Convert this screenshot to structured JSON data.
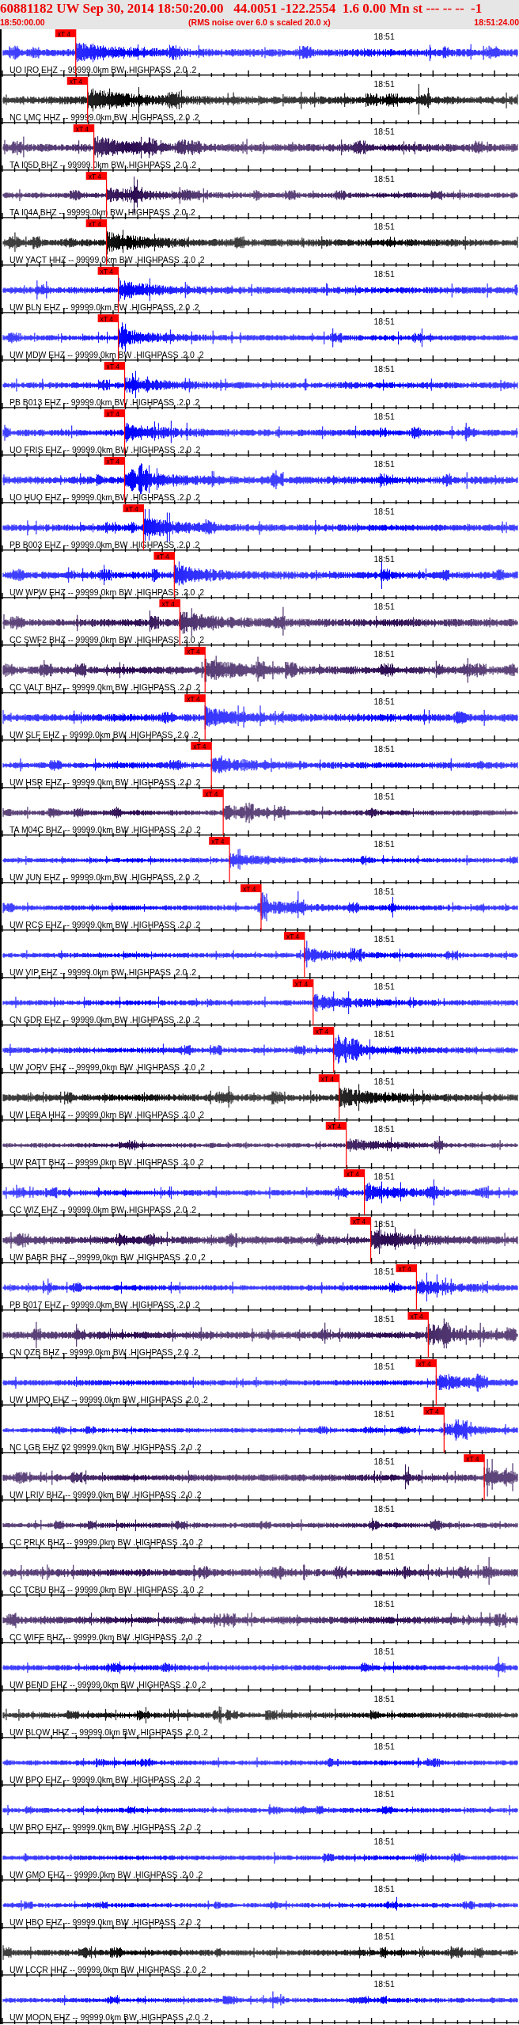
{
  "header": {
    "title": "60881182 UW Sep 30, 2014 18:50:20.00   44.0051 -122.2554  1.6 0.00 Mn st --- -- --  -1",
    "start_time": "18:50:00.00",
    "note": "(RMS noise over 6.0 s scaled 20.0 x)",
    "end_time": "18:51:24.00"
  },
  "traces": [
    {
      "label": "UO IRO EHZ -- 99999.0km BW .HIGHPASS .2.0 .2",
      "color": "#0000ff",
      "time_mark": "18:51",
      "pick": {
        "label": "xT 4",
        "level": 0.143
      }
    },
    {
      "label": "NC LMC HHZ -- 99999.0km BW .HIGHPASS .2.0 .2",
      "color": "#000000",
      "time_mark": "18:51",
      "pick": {
        "label": "xT 4",
        "level": 0.166
      }
    },
    {
      "label": "TA I05D BHZ -- 99999.0km BW .HIGHPASS .2.0 .2",
      "color": "#2a0a50",
      "time_mark": "18:51",
      "pick": {
        "label": "xT 4",
        "level": 0.178
      }
    },
    {
      "label": "TA I04A BHZ -- 99999.0km BW .HIGHPASS .2.0 .2",
      "color": "#2a0a50",
      "time_mark": "18:51",
      "pick": {
        "label": "xT 4",
        "level": 0.203
      }
    },
    {
      "label": "UW YACT HHZ -- 99999.0km BW .HIGHPASS .2.0 .2",
      "color": "#000000",
      "time_mark": "18:51",
      "pick": {
        "label": "xT 4",
        "level": 0.203
      }
    },
    {
      "label": "UW BLN EHZ -- 99999.0km BW .HIGHPASS .2.0 .2",
      "color": "#0000ff",
      "time_mark": "18:51",
      "pick": {
        "label": "xT 4",
        "level": 0.226
      }
    },
    {
      "label": "UW MDW EHZ -- 99999.0km BW .HIGHPASS .2.0 .2",
      "color": "#0000ff",
      "time_mark": "18:51",
      "pick": {
        "label": "xT 4",
        "level": 0.226
      }
    },
    {
      "label": "PB B013 EHZ -- 99999.0km BW .HIGHPASS .2.0 .2",
      "color": "#0000ff",
      "time_mark": "18:51",
      "pick": {
        "label": "xT 4",
        "level": 0.238
      }
    },
    {
      "label": "UO FRIS EHZ -- 99999.0km BW .HIGHPASS .2.0 .2",
      "color": "#0000ff",
      "time_mark": "18:51",
      "pick": {
        "label": "xT 4",
        "level": 0.238
      }
    },
    {
      "label": "UO HUO EHZ -- 99999.0km BW .HIGHPASS .2.0 .2",
      "color": "#0000ff",
      "time_mark": "18:51",
      "pick": {
        "label": "xT 4",
        "level": 0.238
      }
    },
    {
      "label": "PB B003 EHZ -- 99999.0km BW .HIGHPASS .2.0 .2",
      "color": "#0000ff",
      "time_mark": "18:51",
      "pick": {
        "label": "xT 4",
        "level": 0.274
      }
    },
    {
      "label": "UW WPW EHZ -- 99999.0km BW .HIGHPASS .2.0 .2",
      "color": "#0000ff",
      "time_mark": "18:51",
      "pick": {
        "label": "xT 4",
        "level": 0.334
      }
    },
    {
      "label": "CC SWF2 BHZ -- 99999.0km BW .HIGHPASS .2.0 .2",
      "color": "#2a0a50",
      "time_mark": "18:51",
      "pick": {
        "label": "xT 4",
        "level": 0.345
      }
    },
    {
      "label": "CC VALT BHZ -- 99999.0km BW .HIGHPASS .2.0 .2",
      "color": "#2a0a50",
      "time_mark": "18:51",
      "pick": {
        "label": "xT 4",
        "level": 0.393
      }
    },
    {
      "label": "UW SLF EHZ -- 99999.0km BW .HIGHPASS .2.0 .2",
      "color": "#0000ff",
      "time_mark": "18:51",
      "pick": {
        "label": "xT 4",
        "level": 0.393
      }
    },
    {
      "label": "UW HSR EHZ -- 99999.0km BW .HIGHPASS .2.0 .2",
      "color": "#0000ff",
      "time_mark": "18:51",
      "pick": {
        "label": "xT 4",
        "level": 0.406
      }
    },
    {
      "label": "TA M04C BHZ -- 99999.0km BW .HIGHPASS .2.0 .2",
      "color": "#2a0a50",
      "time_mark": "18:51",
      "pick": {
        "label": "xT 4",
        "level": 0.429
      }
    },
    {
      "label": "UW JUN EHZ -- 99999.0km BW .HIGHPASS .2.0 .2",
      "color": "#0000ff",
      "time_mark": "18:51",
      "pick": {
        "label": "xT 4",
        "level": 0.441
      }
    },
    {
      "label": "UW RCS EHZ -- 99999.0km BW .HIGHPASS .2.0 .2",
      "color": "#0000ff",
      "time_mark": "18:51",
      "pick": {
        "label": "xT 4",
        "level": 0.502
      }
    },
    {
      "label": "UW VIP EHZ -- 99999.0km BW .HIGHPASS .2.0 .2",
      "color": "#0000ff",
      "time_mark": "18:51",
      "pick": {
        "label": "xT 4",
        "level": 0.585
      }
    },
    {
      "label": "CN GDR EHZ -- 99999.0km BW .HIGHPASS .2.0 .2",
      "color": "#0000ff",
      "time_mark": "18:51",
      "pick": {
        "label": "xT 4",
        "level": 0.602
      }
    },
    {
      "label": "UW JORV EHZ -- 99999.0km BW .HIGHPASS .2.0 .2",
      "color": "#0000ff",
      "time_mark": "18:51",
      "pick": {
        "label": "xT 4",
        "level": 0.642
      }
    },
    {
      "label": "UW LEBA HHZ -- 99999.0km BW .HIGHPASS .2.0 .2",
      "color": "#000000",
      "time_mark": "18:51",
      "pick": {
        "label": "xT 4",
        "level": 0.652
      }
    },
    {
      "label": "UW RATT BHZ -- 99999.0km BW .HIGHPASS .2.0 .2",
      "color": "#2a0a50",
      "time_mark": "18:51",
      "pick": {
        "label": "xT 4",
        "level": 0.666
      }
    },
    {
      "label": "CC WIZ EHZ -- 99999.0km BW .HIGHPASS .2.0 .2",
      "color": "#0000ff",
      "time_mark": "18:51",
      "pick": {
        "label": "xT 4",
        "level": 0.701
      }
    },
    {
      "label": "UW BABR BHZ -- 99999.0km BW .HIGHPASS .2.0 .2",
      "color": "#2a0a50",
      "time_mark": "18:51",
      "pick": {
        "label": "xT 4",
        "level": 0.714
      }
    },
    {
      "label": "PB B017 EHZ -- 99999.0km BW .HIGHPASS .2.0 .2",
      "color": "#0000ff",
      "time_mark": "18:51",
      "pick": {
        "label": "xT 4",
        "level": 0.802
      }
    },
    {
      "label": "CN OZB BHZ -- 99999.0km BW .HIGHPASS .2.0 .2",
      "color": "#2a0a50",
      "time_mark": "18:51",
      "pick": {
        "label": "xT 4",
        "level": 0.825
      }
    },
    {
      "label": "UW UMPQ EHZ -- 99999.0km BW .HIGHPASS .2.0 .2",
      "color": "#0000ff",
      "time_mark": "18:51",
      "pick": {
        "label": "xT 4",
        "level": 0.84
      }
    },
    {
      "label": "NC LGB EHZ 02 99999.0km BW .HIGHPASS .2.0 .2",
      "color": "#0000ff",
      "time_mark": "18:51",
      "pick": {
        "label": "xT 4",
        "level": 0.855
      }
    },
    {
      "label": "UW LRIV BHZ -- 99999.0km BW .HIGHPASS .2.0 .2",
      "color": "#2a0a50",
      "time_mark": "18:51",
      "pick": {
        "label": "xT 4",
        "level": 0.933
      }
    },
    {
      "label": "CC PRLK BHZ -- 99999.0km BW .HIGHPASS .2.0 .2",
      "color": "#2a0a50",
      "time_mark": "18:51"
    },
    {
      "label": "CC TCBU BHZ -- 99999.0km BW .HIGHPASS .2.0 .2",
      "color": "#2a0a50",
      "time_mark": "18:51"
    },
    {
      "label": "CC WIFE BHZ -- 99999.0km BW .HIGHPASS .2.0 .2",
      "color": "#2a0a50",
      "time_mark": "18:51"
    },
    {
      "label": "UW BEND EHZ -- 99999.0km BW .HIGHPASS .2.0 .2",
      "color": "#0000ff",
      "time_mark": "18:51"
    },
    {
      "label": "UW BLOW HHZ -- 99999.0km BW .HIGHPASS .2.0 .2",
      "color": "#000000",
      "time_mark": "18:51"
    },
    {
      "label": "UW BPO EHZ -- 99999.0km BW .HIGHPASS .2.0 .2",
      "color": "#0000ff",
      "time_mark": "18:51"
    },
    {
      "label": "UW BRO EHZ -- 99999.0km BW .HIGHPASS .2.0 .2",
      "color": "#0000ff",
      "time_mark": "18:51"
    },
    {
      "label": "UW GMO EHZ -- 99999.0km BW .HIGHPASS .2.0 .2",
      "color": "#0000ff",
      "time_mark": "18:51"
    },
    {
      "label": "UW HBO EHZ -- 99999.0km BW .HIGHPASS .2.0 .2",
      "color": "#0000ff",
      "time_mark": "18:51"
    },
    {
      "label": "UW LCCR HHZ -- 99999.0km BW .HIGHPASS .2.0 .2",
      "color": "#000000",
      "time_mark": "18:51"
    },
    {
      "label": "UW MOON EHZ -- 99999.0km BW .HIGHPASS .2.0 .2",
      "color": "#0000ff",
      "time_mark": "18:51"
    }
  ]
}
